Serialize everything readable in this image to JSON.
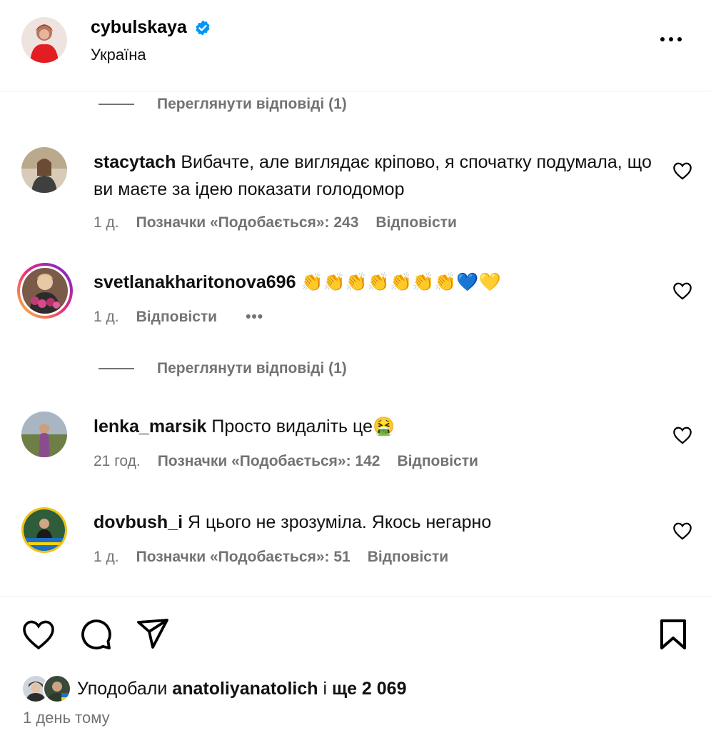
{
  "header": {
    "username": "cybulskaya",
    "location": "Україна"
  },
  "view_replies_label": "Переглянути відповіді (1)",
  "comments": [
    {
      "username": "stacytach",
      "text": "Вибачте, але виглядає кріпово, я спочатку подумала, що ви маєте за ідею показати голодомор",
      "time": "1 д.",
      "likes": "Позначки «Подобається»: 243",
      "reply": "Відповісти"
    },
    {
      "username": "svetlanakharitonova696",
      "text": "👏👏👏👏👏👏👏💙💛",
      "time": "1 д.",
      "reply": "Відповісти",
      "more": "•••"
    },
    {
      "username": "lenka_marsik",
      "text": "Просто видаліть це🤮",
      "time": "21 год.",
      "likes": "Позначки «Подобається»: 142",
      "reply": "Відповісти"
    },
    {
      "username": "dovbush_i",
      "text": "Я цього не зрозуміла. Якось негарно",
      "time": "1 д.",
      "likes": "Позначки «Подобається»: 51",
      "reply": "Відповісти"
    }
  ],
  "footer": {
    "liked_prefix": "Уподобали",
    "liked_user": "anatoliyanatolich",
    "liked_and": "і",
    "liked_more": "ще 2 069",
    "date": "1 день тому"
  },
  "icons": [
    "verified-badge-icon",
    "more-icon",
    "heart-icon",
    "comment-icon",
    "share-icon",
    "bookmark-icon"
  ],
  "colors": {
    "verified": "#0095f6",
    "muted": "#737373",
    "story_ring_start": "#f9ce34",
    "story_ring_end": "#c13584"
  }
}
